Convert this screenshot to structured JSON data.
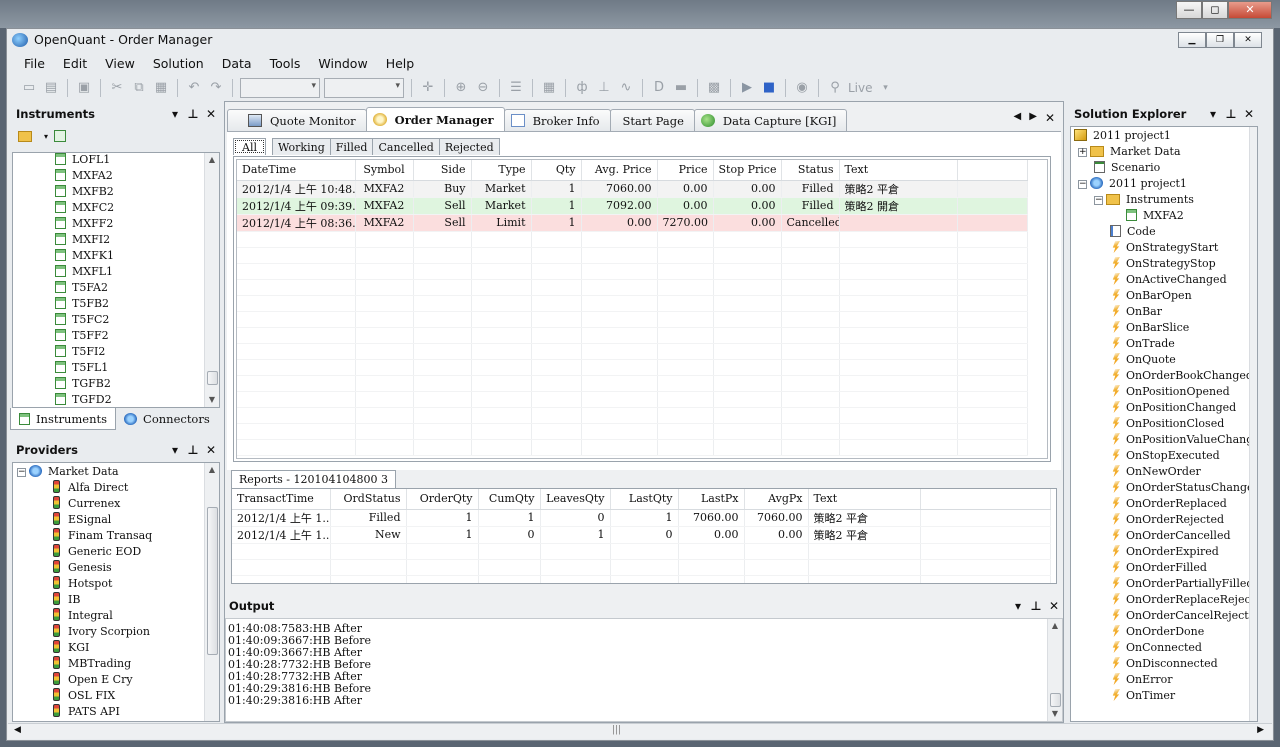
{
  "window": {
    "title": "OpenQuant - Order Manager",
    "minimize_label": "—",
    "maximize_label": "◻",
    "close_label": "✕"
  },
  "menu": [
    "File",
    "Edit",
    "View",
    "Solution",
    "Data",
    "Tools",
    "Window",
    "Help"
  ],
  "toolbar": {
    "live_label": "Live"
  },
  "instruments": {
    "title": "Instruments",
    "items": [
      "LOFL1",
      "MXFA2",
      "MXFB2",
      "MXFC2",
      "MXFF2",
      "MXFI2",
      "MXFK1",
      "MXFL1",
      "T5FA2",
      "T5FB2",
      "T5FC2",
      "T5FF2",
      "T5FI2",
      "T5FL1",
      "TGFB2",
      "TGFD2"
    ],
    "tabs": [
      "Instruments",
      "Connectors"
    ]
  },
  "providers": {
    "title": "Providers",
    "root": "Market Data",
    "items": [
      "Alfa Direct",
      "Currenex",
      "ESignal",
      "Finam Transaq",
      "Generic EOD",
      "Genesis",
      "Hotspot",
      "IB",
      "Integral",
      "Ivory Scorpion",
      "KGI",
      "MBTrading",
      "Open E Cry",
      "OSL FIX",
      "PATS API"
    ]
  },
  "doc_tabs": [
    "Quote Monitor",
    "Order Manager",
    "Broker Info",
    "Start Page",
    "Data Capture [KGI]"
  ],
  "order_tabs": [
    "All",
    "Working",
    "Filled",
    "Cancelled",
    "Rejected"
  ],
  "orders": {
    "columns": [
      "DateTime",
      "Symbol",
      "Side",
      "Type",
      "Qty",
      "Avg. Price",
      "Price",
      "Stop Price",
      "Status",
      "Text"
    ],
    "rows": [
      [
        "2012/1/4 上午 10:48...",
        "MXFA2",
        "Buy",
        "Market",
        "1",
        "7060.00",
        "0.00",
        "0.00",
        "Filled",
        "策略2 平倉"
      ],
      [
        "2012/1/4 上午 09:39...",
        "MXFA2",
        "Sell",
        "Market",
        "1",
        "7092.00",
        "0.00",
        "0.00",
        "Filled",
        "策略2 開倉"
      ],
      [
        "2012/1/4 上午 08:36...",
        "MXFA2",
        "Sell",
        "Limit",
        "1",
        "0.00",
        "7270.00",
        "0.00",
        "Cancelled",
        ""
      ]
    ]
  },
  "reports": {
    "tab": "Reports - 120104104800 3",
    "columns": [
      "TransactTime",
      "OrdStatus",
      "OrderQty",
      "CumQty",
      "LeavesQty",
      "LastQty",
      "LastPx",
      "AvgPx",
      "Text"
    ],
    "rows": [
      [
        "2012/1/4 上午 1...",
        "Filled",
        "1",
        "1",
        "0",
        "1",
        "7060.00",
        "7060.00",
        "策略2 平倉"
      ],
      [
        "2012/1/4 上午 1...",
        "New",
        "1",
        "0",
        "1",
        "0",
        "0.00",
        "0.00",
        "策略2 平倉"
      ]
    ]
  },
  "output": {
    "title": "Output",
    "lines": [
      "01:40:08:7583:HB After",
      "01:40:09:3667:HB Before",
      "01:40:09:3667:HB After",
      "01:40:28:7732:HB Before",
      "01:40:28:7732:HB After",
      "01:40:29:3816:HB Before",
      "01:40:29:3816:HB After"
    ]
  },
  "solution": {
    "title": "Solution Explorer",
    "project": "2011 project1",
    "market_data": "Market Data",
    "scenario": "Scenario",
    "strategy": "2011 project1",
    "instruments_folder": "Instruments",
    "instrument": "MXFA2",
    "code": "Code",
    "events": [
      "OnStrategyStart",
      "OnStrategyStop",
      "OnActiveChanged",
      "OnBarOpen",
      "OnBar",
      "OnBarSlice",
      "OnTrade",
      "OnQuote",
      "OnOrderBookChanged",
      "OnPositionOpened",
      "OnPositionChanged",
      "OnPositionClosed",
      "OnPositionValueChanged",
      "OnStopExecuted",
      "OnNewOrder",
      "OnOrderStatusChanged",
      "OnOrderReplaced",
      "OnOrderRejected",
      "OnOrderCancelled",
      "OnOrderExpired",
      "OnOrderFilled",
      "OnOrderPartiallyFilled",
      "OnOrderReplaceReject",
      "OnOrderCancelReject",
      "OnOrderDone",
      "OnConnected",
      "OnDisconnected",
      "OnError",
      "OnTimer"
    ]
  }
}
